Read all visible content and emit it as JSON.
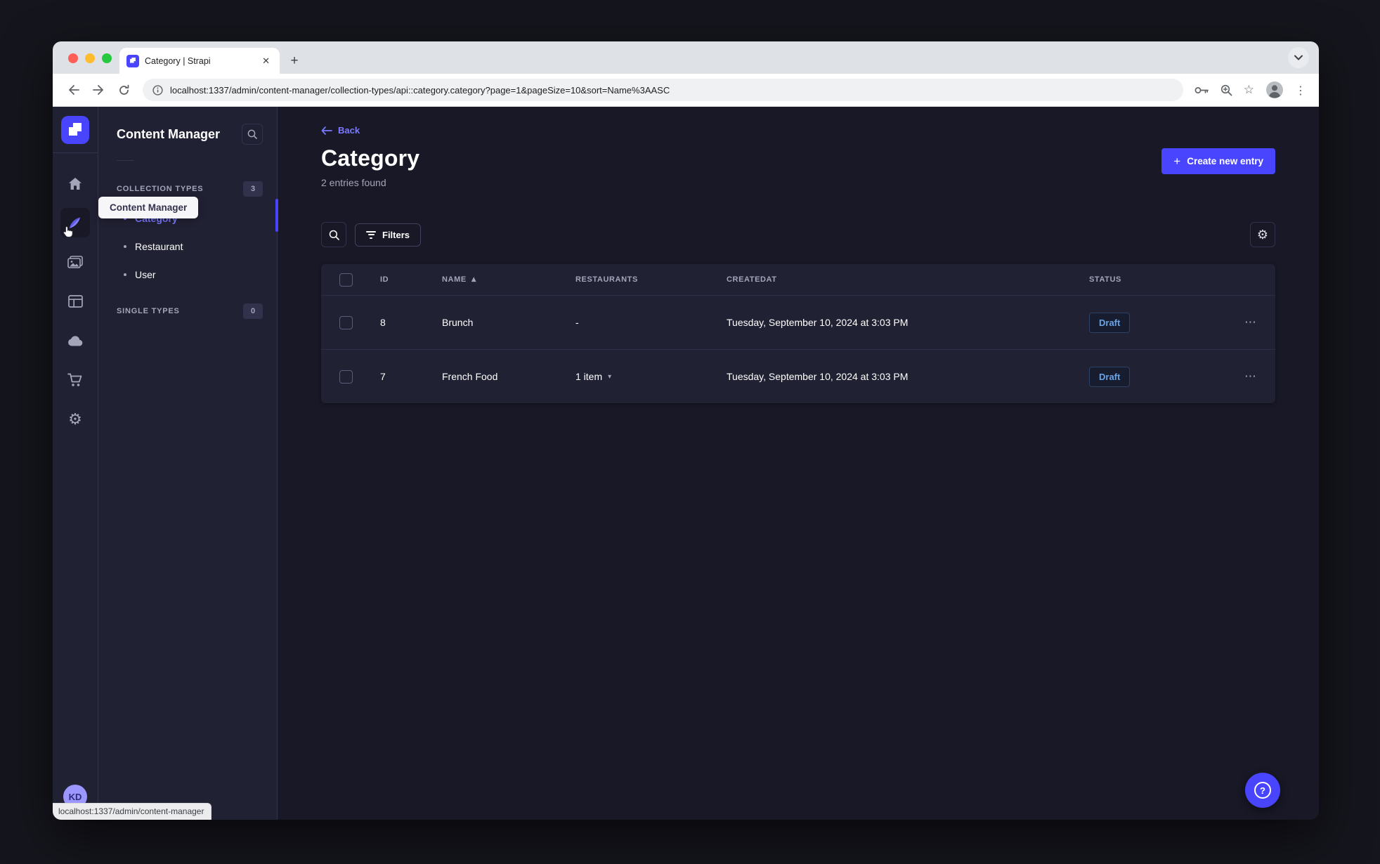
{
  "browser": {
    "tab_title": "Category | Strapi",
    "close_tab_glyph": "✕",
    "new_tab_glyph": "+",
    "url": "localhost:1337/admin/content-manager/collection-types/api::category.category?page=1&pageSize=10&sort=Name%3AASC",
    "status_link": "localhost:1337/admin/content-manager",
    "star_glyph": "☆",
    "kebab_glyph": "⋮"
  },
  "sidebar": {
    "tooltip": "Content Manager",
    "avatar_initials": "KD",
    "gear_glyph": "⚙"
  },
  "subnav": {
    "title": "Content Manager",
    "collection_types_label": "COLLECTION TYPES",
    "collection_types_count": "3",
    "single_types_label": "SINGLE TYPES",
    "single_types_count": "0",
    "items": [
      {
        "label": "Category",
        "active": true
      },
      {
        "label": "Restaurant",
        "active": false
      },
      {
        "label": "User",
        "active": false
      }
    ]
  },
  "main": {
    "back_label": "Back",
    "title": "Category",
    "entries_found": "2 entries found",
    "create_button_label": "Create new entry",
    "plus_glyph": "+",
    "filters_label": "Filters",
    "settings_gear_glyph": "⚙",
    "table": {
      "headers": [
        "ID",
        "NAME",
        "RESTAURANTS",
        "CREATEDAT",
        "STATUS"
      ],
      "sort_asc_glyph": "▲",
      "dropdown_glyph": "▾",
      "kebab_glyph": "⋯",
      "rows": [
        {
          "id": "8",
          "name": "Brunch",
          "restaurants": "-",
          "created": "Tuesday, September 10, 2024 at 3:03 PM",
          "status": "Draft"
        },
        {
          "id": "7",
          "name": "French Food",
          "restaurants": "1 item",
          "created": "Tuesday, September 10, 2024 at 3:03 PM",
          "status": "Draft"
        }
      ]
    }
  },
  "help": {
    "label": "?"
  },
  "colors": {
    "accent": "#4945ff",
    "accent_light": "#7b79ff",
    "app_background": "#181826",
    "panel_background": "#212134",
    "border": "#32324d",
    "muted_text": "#a5a5ba",
    "draft_text": "#66a4e8"
  }
}
